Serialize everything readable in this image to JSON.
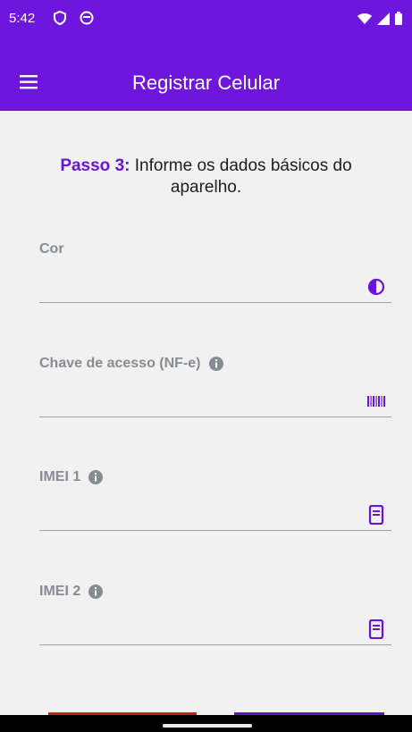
{
  "status_bar": {
    "time": "5:42",
    "left_icons": [
      "shield-icon",
      "record-icon"
    ],
    "right_icons": [
      "wifi-icon",
      "signal-icon",
      "battery-icon"
    ]
  },
  "app_bar": {
    "title": "Registrar Celular",
    "menu_icon": "hamburger-icon",
    "background": "#6f16dd"
  },
  "step": {
    "prefix": "Passo 3:",
    "text": " Informe os dados básicos do aparelho."
  },
  "fields": [
    {
      "label": "Cor",
      "value": "",
      "icon": "color-drop-icon",
      "info": false
    },
    {
      "label": "Chave de acesso (NF-e)",
      "value": "",
      "icon": "barcode-icon",
      "info": true
    },
    {
      "label": "IMEI 1",
      "value": "",
      "icon": "phone-icon",
      "info": true
    },
    {
      "label": "IMEI 2",
      "value": "",
      "icon": "phone-icon",
      "info": true
    }
  ],
  "colors": {
    "accent": "#6a14d6",
    "label": "#868c93",
    "underline": "#9aa2aa",
    "danger": "#d11a1a"
  }
}
